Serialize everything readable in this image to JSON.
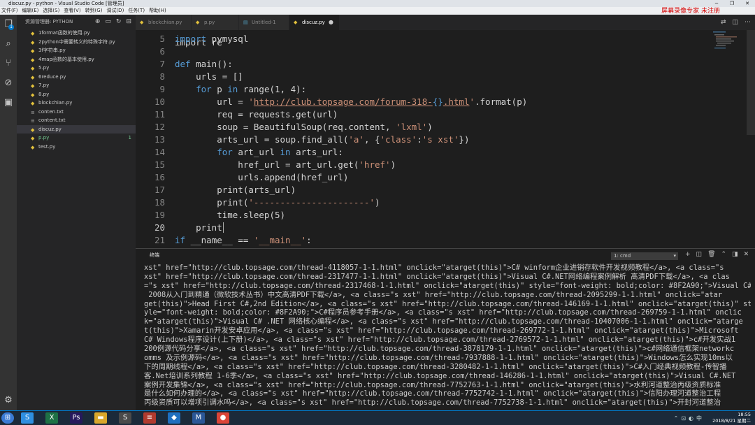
{
  "window": {
    "title": "discuz.py - python - Visual Studio Code [管理员]",
    "recording_badge": "屏幕录像专家 未注册",
    "controls": [
      "─",
      "❐",
      "✕"
    ]
  },
  "menu": [
    "文件(F)",
    "编辑(E)",
    "选择(S)",
    "查看(V)",
    "转到(G)",
    "调试(D)",
    "任务(T)",
    "帮助(H)"
  ],
  "activity_bar": {
    "badge": "1",
    "icons": [
      "explorer-icon",
      "search-icon",
      "source-control-icon",
      "debug-icon",
      "extensions-icon",
      "settings-gear-icon"
    ]
  },
  "sidebar": {
    "title": "资源管理器: PYTHON",
    "files": [
      {
        "name": "1format函数的使用.py"
      },
      {
        "name": "2python中需要转义的特殊字符.py"
      },
      {
        "name": "3f字符串.py"
      },
      {
        "name": "4map函数的基本使用.py"
      },
      {
        "name": "5.py"
      },
      {
        "name": "6reduce.py"
      },
      {
        "name": "7.py"
      },
      {
        "name": "8.py"
      },
      {
        "name": "blockchian.py"
      },
      {
        "name": "conten.txt"
      },
      {
        "name": "content.txt"
      },
      {
        "name": "discuz.py",
        "selected": true
      },
      {
        "name": "p.py",
        "modified": true,
        "count": "1"
      },
      {
        "name": "test.py"
      }
    ]
  },
  "tabs": [
    {
      "label": "blockchian.py"
    },
    {
      "label": "p.py"
    },
    {
      "label": "Untitled-1"
    },
    {
      "label": "discuz.py",
      "active": true,
      "dirty": "●"
    }
  ],
  "editor": {
    "partial_top": "import re",
    "lines": [
      {
        "n": "5",
        "parts": [
          [
            "kw",
            "import"
          ],
          [
            "t",
            " pymysql"
          ]
        ]
      },
      {
        "n": "6",
        "parts": []
      },
      {
        "n": "7",
        "parts": [
          [
            "kw",
            "def"
          ],
          [
            "t",
            " main():"
          ]
        ]
      },
      {
        "n": "8",
        "parts": [
          [
            "t",
            "    urls = []"
          ]
        ]
      },
      {
        "n": "9",
        "parts": [
          [
            "t",
            "    "
          ],
          [
            "kw",
            "for"
          ],
          [
            "t",
            " p "
          ],
          [
            "kw",
            "in"
          ],
          [
            "t",
            " range(1, 4):"
          ]
        ]
      },
      {
        "n": "10",
        "parts": [
          [
            "t",
            "        url = "
          ],
          [
            "str",
            "'"
          ],
          [
            "url",
            "http://club.topsage.com/forum-318-"
          ],
          [
            "fmt",
            "{}"
          ],
          [
            "url",
            ".html"
          ],
          [
            "str",
            "'"
          ],
          [
            "t",
            ".format(p)"
          ]
        ]
      },
      {
        "n": "11",
        "parts": [
          [
            "t",
            "        req = requests.get(url)"
          ]
        ]
      },
      {
        "n": "12",
        "parts": [
          [
            "t",
            "        soup = BeautifulSoup(req.content, "
          ],
          [
            "str",
            "'lxml'"
          ],
          [
            "t",
            ")"
          ]
        ]
      },
      {
        "n": "13",
        "parts": [
          [
            "t",
            "        arts_url = soup.find_all("
          ],
          [
            "str",
            "'a'"
          ],
          [
            "t",
            ", {"
          ],
          [
            "str",
            "'class'"
          ],
          [
            "t",
            ":"
          ],
          [
            "str",
            "'s xst'"
          ],
          [
            "t",
            "})"
          ]
        ]
      },
      {
        "n": "14",
        "parts": [
          [
            "t",
            "        "
          ],
          [
            "kw",
            "for"
          ],
          [
            "t",
            " art_url "
          ],
          [
            "kw",
            "in"
          ],
          [
            "t",
            " arts_url:"
          ]
        ]
      },
      {
        "n": "15",
        "parts": [
          [
            "t",
            "            href_url = art_url.get("
          ],
          [
            "str",
            "'href'"
          ],
          [
            "t",
            ")"
          ]
        ]
      },
      {
        "n": "16",
        "parts": [
          [
            "t",
            "            urls.append(href_url)"
          ]
        ]
      },
      {
        "n": "17",
        "parts": [
          [
            "t",
            "        print(arts_url)"
          ]
        ]
      },
      {
        "n": "18",
        "parts": [
          [
            "t",
            "        print("
          ],
          [
            "str",
            "'----------------------'"
          ],
          [
            "t",
            ")"
          ]
        ]
      },
      {
        "n": "19",
        "parts": [
          [
            "t",
            "        time.sleep(5)"
          ]
        ]
      },
      {
        "n": "20",
        "parts": [
          [
            "t",
            "    print"
          ]
        ],
        "current": true
      },
      {
        "n": "21",
        "parts": [
          [
            "kw",
            "if"
          ],
          [
            "t",
            " __name__ == "
          ],
          [
            "str",
            "'__main__'"
          ],
          [
            "t",
            ":"
          ]
        ]
      }
    ]
  },
  "panel": {
    "title": "终端",
    "terminal_select": "1: cmd",
    "tools": [
      "+",
      "◫",
      "🗑",
      "⌃",
      "◨",
      "✕"
    ],
    "lines": [
      "xst\" href=\"http://club.topsage.com/thread-4118057-1-1.html\" onclick=\"atarget(this)\">C# winform企业进销存软件开发视频教程</a>, <a class=\"s",
      "xst\" href=\"http://club.topsage.com/thread-2317477-1-1.html\" onclick=\"atarget(this)\">Visual C#.NET网络编程案例解析 高清PDF下载</a>, <a clas",
      "=\"s xst\" href=\"http://club.topsage.com/thread-2317468-1-1.html\" onclick=\"atarget(this)\" style=\"font-weight: bold;color: #8F2A90;\">Visual C#",
      " 2008从入门到精通（微软技术丛书）中文高清PDF下载</a>, <a class=\"s xst\" href=\"http://club.topsage.com/thread-2095299-1-1.html\" onclick=\"atar",
      "get(this)\">Head First C#,2nd Edition</a>, <a class=\"s xst\" href=\"http://club.topsage.com/thread-146169-1-1.html\" onclick=\"atarget(this)\" st",
      "yle=\"font-weight: bold;color: #8F2A90;\">C#程序员参考手册</a>, <a class=\"s xst\" href=\"http://club.topsage.com/thread-269759-1-1.html\" onclic",
      "k=\"atarget(this)\">Visual C# .NET 网络核心编程</a>, <a class=\"s xst\" href=\"http://club.topsage.com/thread-10407006-1-1.html\" onclick=\"atarge",
      "t(this)\">Xamarin开发安卓应用</a>, <a class=\"s xst\" href=\"http://club.topsage.com/thread-269772-1-1.html\" onclick=\"atarget(this)\">Microsoft",
      "C# Windows程序设计(上下册)</a>, <a class=\"s xst\" href=\"http://club.topsage.com/thread-2769572-1-1.html\" onclick=\"atarget(this)\">c#开发实战1",
      "200例源代码分享</a>, <a class=\"s xst\" href=\"http://club.topsage.com/thread-3878179-1-1.html\" onclick=\"atarget(this)\">c#网络通信框架networkc",
      "omms 及示例源码</a>, <a class=\"s xst\" href=\"http://club.topsage.com/thread-7937888-1-1.html\" onclick=\"atarget(this)\">Windows怎么实现10ms以",
      "下的周期线程</a>, <a class=\"s xst\" href=\"http://club.topsage.com/thread-3280482-1-1.html\" onclick=\"atarget(this)\">C#入门经典视频教程-传智播",
      "客.Net培训系列教程 1-6季</a>, <a class=\"s xst\" href=\"http://club.topsage.com/thread-146286-1-1.html\" onclick=\"atarget(this)\">Visual C#.NET",
      "案例开发集锦</a>, <a class=\"s xst\" href=\"http://club.topsage.com/thread-7752763-1-1.html\" onclick=\"atarget(this)\">水利河道整治丙级资质标准",
      "是什么如何办理的</a>, <a class=\"s xst\" href=\"http://club.topsage.com/thread-7752742-1-1.html\" onclick=\"atarget(this)\">信阳办理河道整治工程",
      "丙级资质可以增项引调水吗</a>, <a class=\"s xst\" href=\"http://club.topsage.com/thread-7752738-1-1.html\" onclick=\"atarget(this)\">开封河道整治"
    ]
  },
  "taskbar": {
    "apps": [
      {
        "icon": "start-icon",
        "glyph": "⊞",
        "color": "#3a7bd5"
      },
      {
        "icon": "sogou-icon",
        "glyph": "S",
        "color": "#2f8fe0"
      },
      {
        "icon": "excel-icon",
        "glyph": "X",
        "color": "#1e7145"
      },
      {
        "icon": "photoshop-icon",
        "glyph": "Ps",
        "color": "#26195c"
      },
      {
        "icon": "folder-icon",
        "glyph": "▬",
        "color": "#d9a72b"
      },
      {
        "icon": "sublime-icon",
        "glyph": "S",
        "color": "#4a4a4a"
      },
      {
        "icon": "books-icon",
        "glyph": "≡",
        "color": "#b03a2e"
      },
      {
        "icon": "vscode-icon",
        "glyph": "◆",
        "color": "#1f6fbf"
      },
      {
        "icon": "app-icon",
        "glyph": "M",
        "color": "#2b5797"
      },
      {
        "icon": "chrome-icon",
        "glyph": "●",
        "color": "#db4437"
      }
    ],
    "clock_time": "18:55",
    "clock_date": "2018/8/21 星期二"
  }
}
